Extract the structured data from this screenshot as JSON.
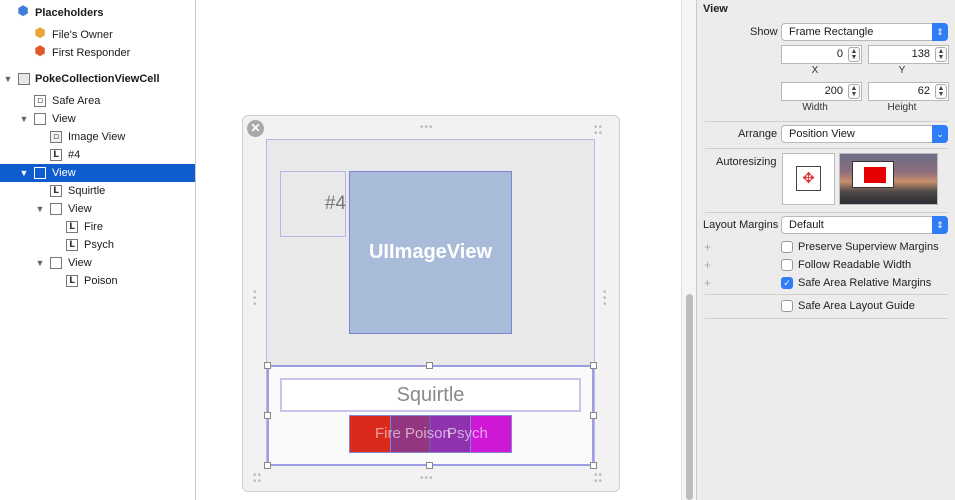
{
  "outline": {
    "items": [
      {
        "label": "Placeholders",
        "bold": true,
        "icon": "cube-icon"
      },
      {
        "label": "File's Owner",
        "icon": "cube-icon"
      },
      {
        "label": "First Responder",
        "icon": "cube-icon"
      },
      {
        "label": "PokeCollectionViewCell",
        "bold": true,
        "icon": "collection-cell-icon"
      },
      {
        "label": "Safe Area",
        "icon": "view-icon"
      },
      {
        "label": "View",
        "icon": "view-icon"
      },
      {
        "label": "Image View",
        "icon": "image-view-icon"
      },
      {
        "label": "#4",
        "icon": "label-icon"
      },
      {
        "label": "View",
        "icon": "view-icon",
        "selected": true
      },
      {
        "label": "Squirtle",
        "icon": "label-icon"
      },
      {
        "label": "View",
        "icon": "view-icon"
      },
      {
        "label": "Fire",
        "icon": "label-icon"
      },
      {
        "label": "Psych",
        "icon": "label-icon"
      },
      {
        "label": "View",
        "icon": "view-icon"
      },
      {
        "label": "Poison",
        "icon": "label-icon"
      }
    ],
    "label_glyph": "L"
  },
  "canvas": {
    "number_label": "#4",
    "image_view_label": "UIImageView",
    "name_label": "Squirtle",
    "type_fire": "Fire",
    "type_poison": "Poison",
    "type_psych": "Psych",
    "close_glyph": "✕"
  },
  "inspector": {
    "section_title": "View",
    "show_label": "Show",
    "show_value": "Frame Rectangle",
    "x_value": "0",
    "y_value": "138",
    "x_caption": "X",
    "y_caption": "Y",
    "width_value": "200",
    "height_value": "62",
    "width_caption": "Width",
    "height_caption": "Height",
    "arrange_label": "Arrange",
    "arrange_value": "Position View",
    "autoresizing_label": "Autoresizing",
    "layout_margins_label": "Layout Margins",
    "layout_margins_value": "Default",
    "preserve_superview_margins": "Preserve Superview Margins",
    "follow_readable_width": "Follow Readable Width",
    "safe_area_relative_margins": "Safe Area Relative Margins",
    "safe_area_layout_guide": "Safe Area Layout Guide",
    "checkboxes": {
      "preserve_superview_margins": false,
      "follow_readable_width": false,
      "safe_area_relative_margins": true,
      "safe_area_layout_guide": false
    }
  },
  "colors": {
    "selection_blue": "#0f5ccf",
    "type_fire": "#d92a1c",
    "type_psych": "#cf18d6",
    "type_poison": "#7b3aa0",
    "image_view_fill": "#a8bcd9",
    "accent_blue": "#2e7cf6"
  }
}
